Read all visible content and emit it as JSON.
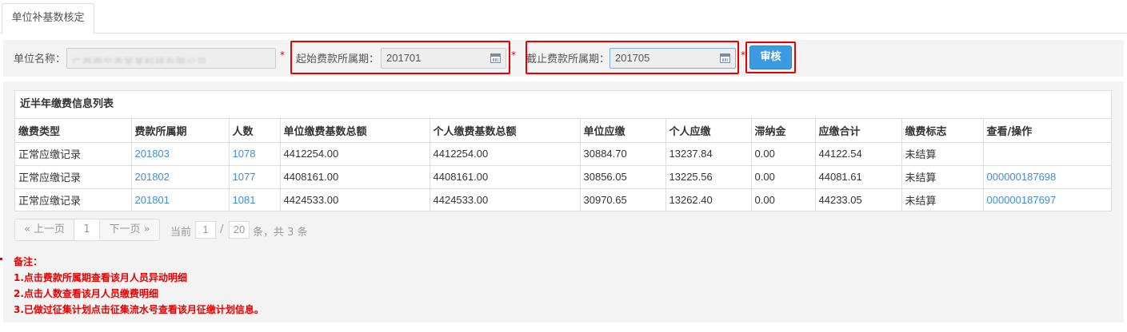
{
  "tab": {
    "label": "单位补基数核定"
  },
  "filter": {
    "unit_name_label": "单位名称：",
    "unit_name_value": "广西南宁市某某科技有限公司",
    "required_mark": "*",
    "start_label": "起始费款所属期：",
    "start_value": "201701",
    "end_label": "截止费款所属期：",
    "end_value": "201705",
    "submit_label": "审核"
  },
  "panel": {
    "title": "近半年缴费信息列表",
    "columns": [
      "缴费类型",
      "费款所属期",
      "人数",
      "单位缴费基数总额",
      "个人缴费基数总额",
      "单位应缴",
      "个人应缴",
      "滞纳金",
      "应缴合计",
      "缴费标志",
      "查看/操作"
    ],
    "rows": [
      {
        "type": "正常应缴记录",
        "period": "201803",
        "count": "1078",
        "unit_base": "4412254.00",
        "personal_base": "4412254.00",
        "unit_due": "30884.70",
        "personal_due": "13237.84",
        "late_fee": "0.00",
        "total": "44122.54",
        "status": "未结算",
        "serial": ""
      },
      {
        "type": "正常应缴记录",
        "period": "201802",
        "count": "1077",
        "unit_base": "4408161.00",
        "personal_base": "4408161.00",
        "unit_due": "30856.05",
        "personal_due": "13225.56",
        "late_fee": "0.00",
        "total": "44081.61",
        "status": "未结算",
        "serial": "000000187698"
      },
      {
        "type": "正常应缴记录",
        "period": "201801",
        "count": "1081",
        "unit_base": "4424533.00",
        "personal_base": "4424533.00",
        "unit_due": "30970.65",
        "personal_due": "13262.40",
        "late_fee": "0.00",
        "total": "44233.05",
        "status": "未结算",
        "serial": "000000187697"
      }
    ]
  },
  "pager": {
    "prev": "« 上一页",
    "page": "1",
    "next": "下一页 »",
    "current_label": "当前",
    "current_page": "1",
    "separator": "/",
    "total_pages": "20",
    "suffix": "条，共 3 条"
  },
  "notes": {
    "title": "备注：",
    "items": [
      "1.点击费款所属期查看该月人员异动明细",
      "2.点击人数查看该月人员缴费明细",
      "3.已做过征集计划点击征集流水号查看该月征缴计划信息。"
    ]
  },
  "colors": {
    "accent": "#3a9be0",
    "highlight": "#e60000",
    "link": "#3d8fd8"
  },
  "icons": {
    "start_calendar": "calendar-icon",
    "end_calendar": "calendar-icon"
  }
}
